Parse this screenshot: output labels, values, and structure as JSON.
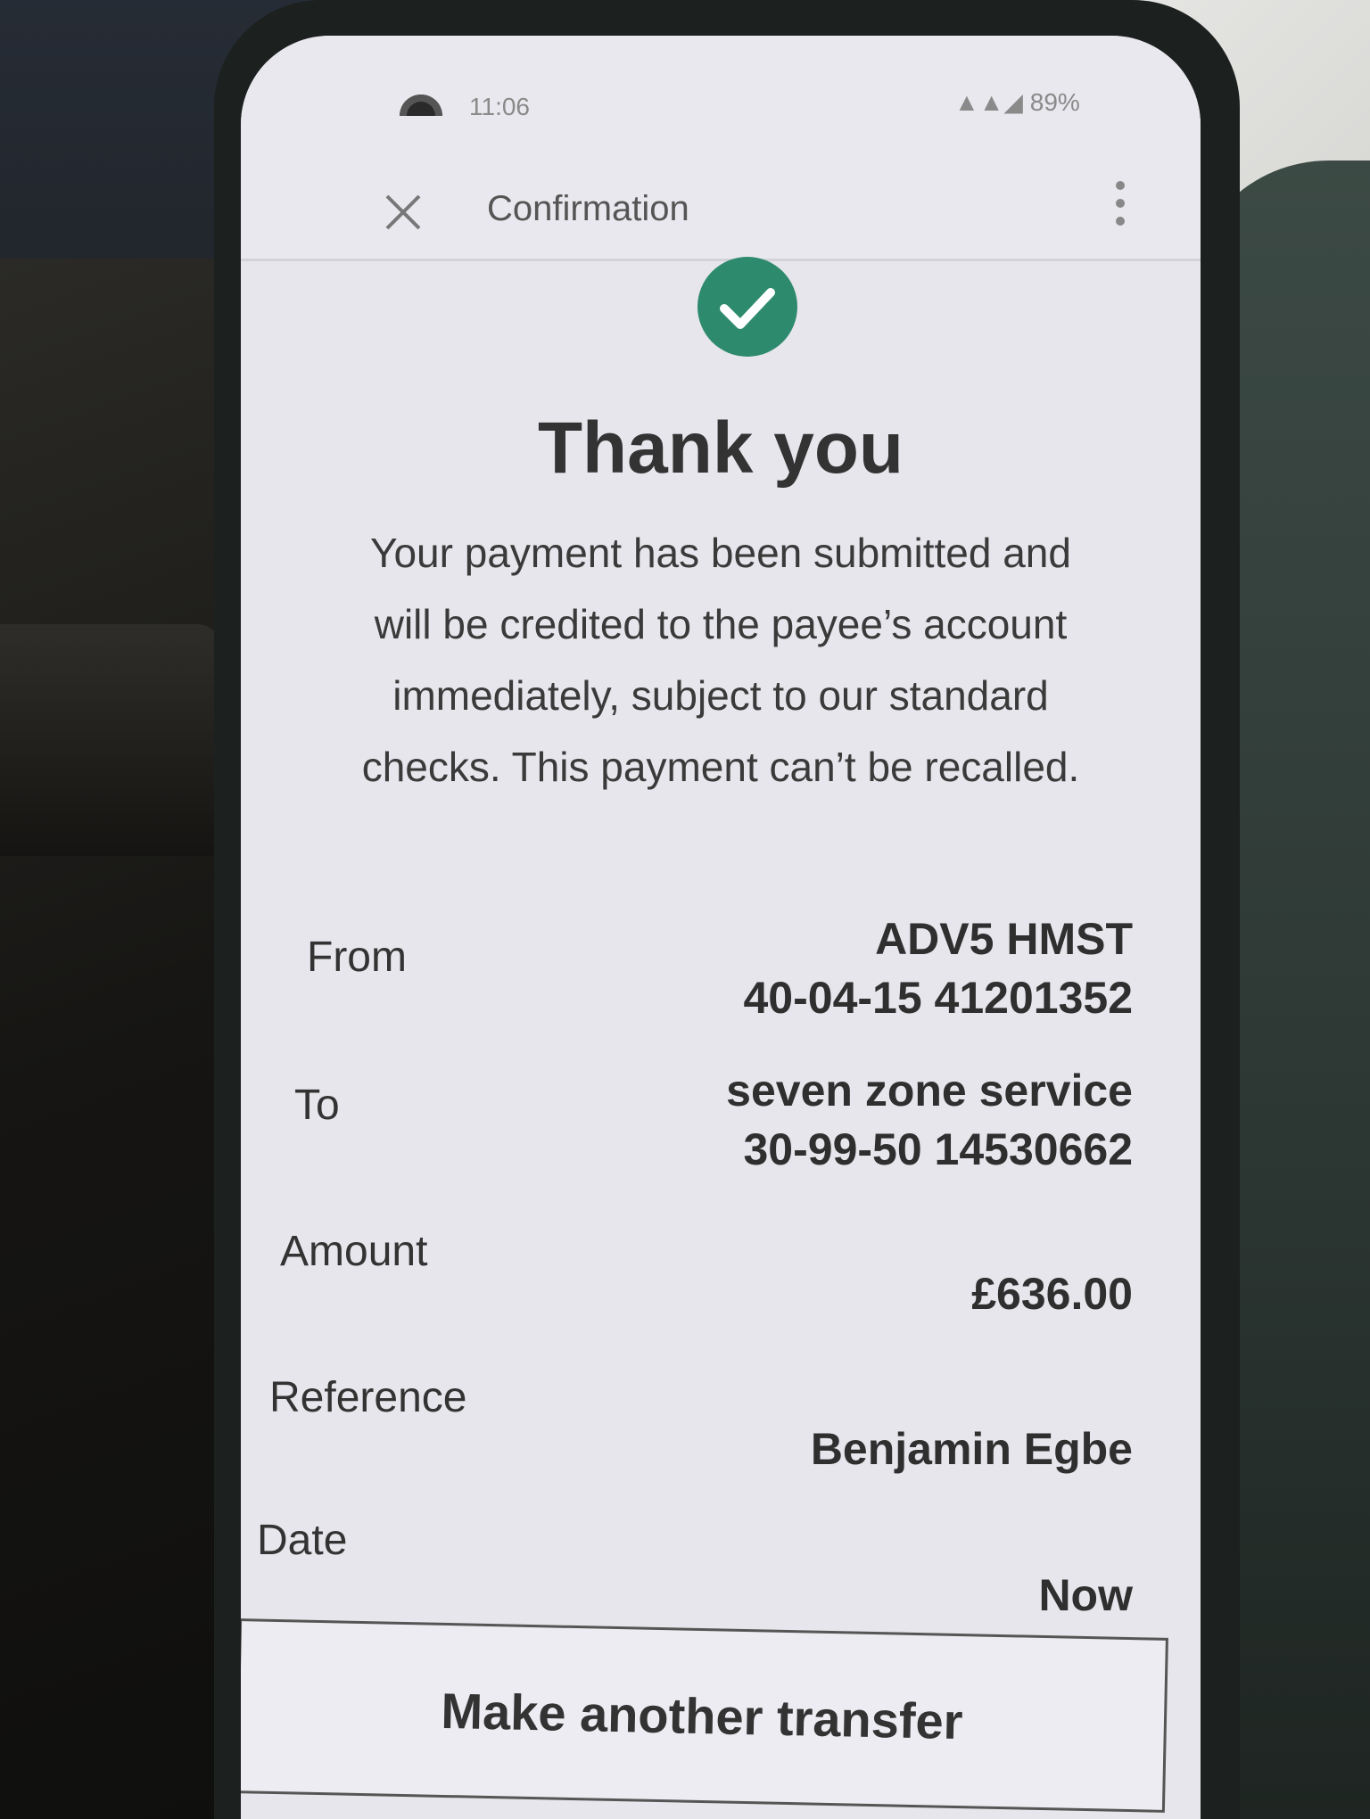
{
  "status_bar": {
    "time": "11:06",
    "battery": "89%"
  },
  "app_bar": {
    "title": "Confirmation"
  },
  "confirmation": {
    "heading": "Thank you",
    "message": "Your payment has been submitted and will be credited to the payee’s account immediately, subject to our standard checks. This payment can’t be recalled."
  },
  "details": {
    "from_label": "From",
    "from_name": "ADV5 HMST",
    "from_account": "40-04-15 41201352",
    "to_label": "To",
    "to_name": "seven zone service",
    "to_account": "30-99-50 14530662",
    "amount_label": "Amount",
    "amount_value": "£636.00",
    "reference_label": "Reference",
    "reference_value": "Benjamin Egbe",
    "date_label": "Date",
    "date_value": "Now"
  },
  "actions": {
    "make_another_transfer": "Make another transfer"
  },
  "colors": {
    "success": "#2e8a6c"
  },
  "icons": {
    "close": "close-icon",
    "more": "more-vertical-icon",
    "success": "check-circle-icon"
  }
}
